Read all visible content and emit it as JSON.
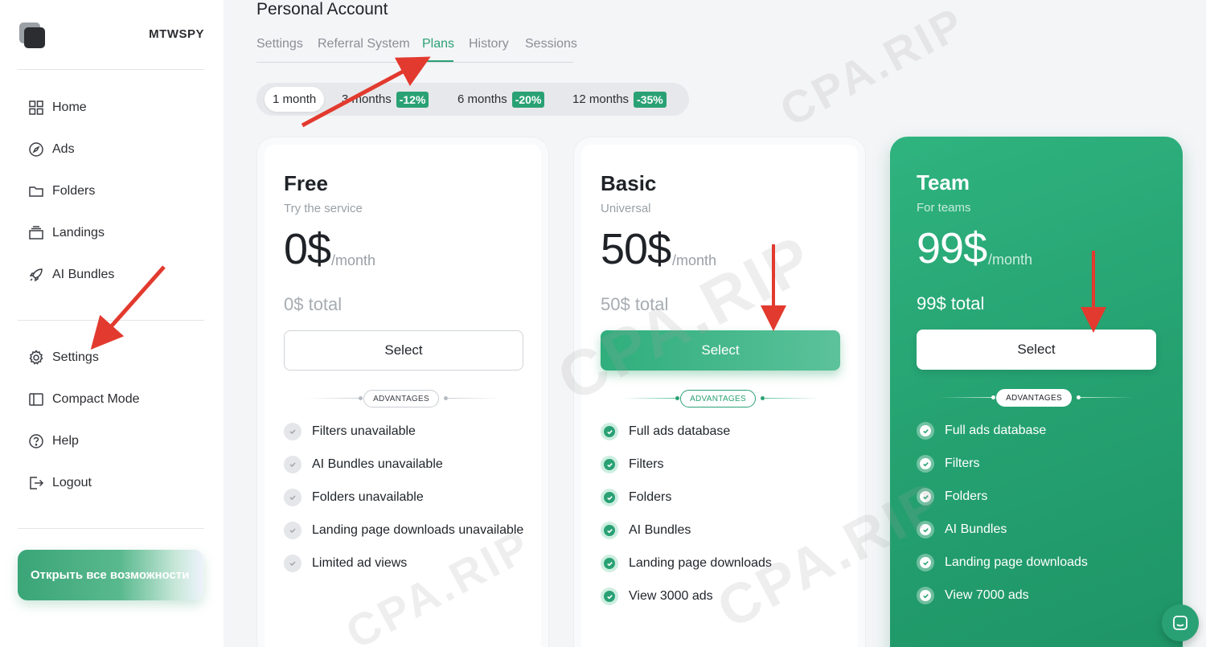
{
  "app": {
    "brand": "MTWSPY"
  },
  "sidebar": {
    "items": [
      {
        "label": "Home",
        "icon": "grid-icon"
      },
      {
        "label": "Ads",
        "icon": "compass-icon"
      },
      {
        "label": "Folders",
        "icon": "folder-icon"
      },
      {
        "label": "Landings",
        "icon": "layers-icon"
      },
      {
        "label": "AI Bundles",
        "icon": "rocket-icon"
      }
    ],
    "bottom_items": [
      {
        "label": "Settings",
        "icon": "gear-icon"
      },
      {
        "label": "Compact Mode",
        "icon": "sidebar-icon"
      },
      {
        "label": "Help",
        "icon": "help-icon"
      },
      {
        "label": "Logout",
        "icon": "logout-icon"
      }
    ],
    "unlock_label": "Открыть все возможности"
  },
  "main": {
    "title": "Personal Account",
    "tabs": [
      {
        "label": "Settings"
      },
      {
        "label": "Referral System"
      },
      {
        "label": "Plans",
        "active": true
      },
      {
        "label": "History"
      },
      {
        "label": "Sessions"
      }
    ],
    "periods": [
      {
        "label": "1 month",
        "discount": "",
        "active": true
      },
      {
        "label": "3 months",
        "discount": "-12%"
      },
      {
        "label": "6 months",
        "discount": "-20%"
      },
      {
        "label": "12 months",
        "discount": "-35%"
      }
    ]
  },
  "plans": [
    {
      "name": "Free",
      "subtitle": "Try the service",
      "price": "0$",
      "per": "/month",
      "total": "0$ total",
      "button": "Select",
      "advantages_label": "ADVANTAGES",
      "features": [
        "Filters unavailable",
        "AI Bundles unavailable",
        "Folders unavailable",
        "Landing page downloads unavailable",
        "Limited ad views"
      ]
    },
    {
      "name": "Basic",
      "subtitle": "Universal",
      "price": "50$",
      "per": "/month",
      "total": "50$ total",
      "button": "Select",
      "advantages_label": "ADVANTAGES",
      "features": [
        "Full ads database",
        "Filters",
        "Folders",
        "AI Bundles",
        "Landing page downloads",
        "View 3000 ads"
      ]
    },
    {
      "name": "Team",
      "subtitle": "For teams",
      "price": "99$",
      "per": "/month",
      "total": "99$ total",
      "button": "Select",
      "advantages_label": "ADVANTAGES",
      "features": [
        "Full ads database",
        "Filters",
        "Folders",
        "AI Bundles",
        "Landing page downloads",
        "View 7000 ads"
      ]
    }
  ],
  "colors": {
    "accent": "#2aa174",
    "arrow": "#e23a2e",
    "watermark": "#a0a0a0"
  },
  "watermark": "CPA.RIP"
}
